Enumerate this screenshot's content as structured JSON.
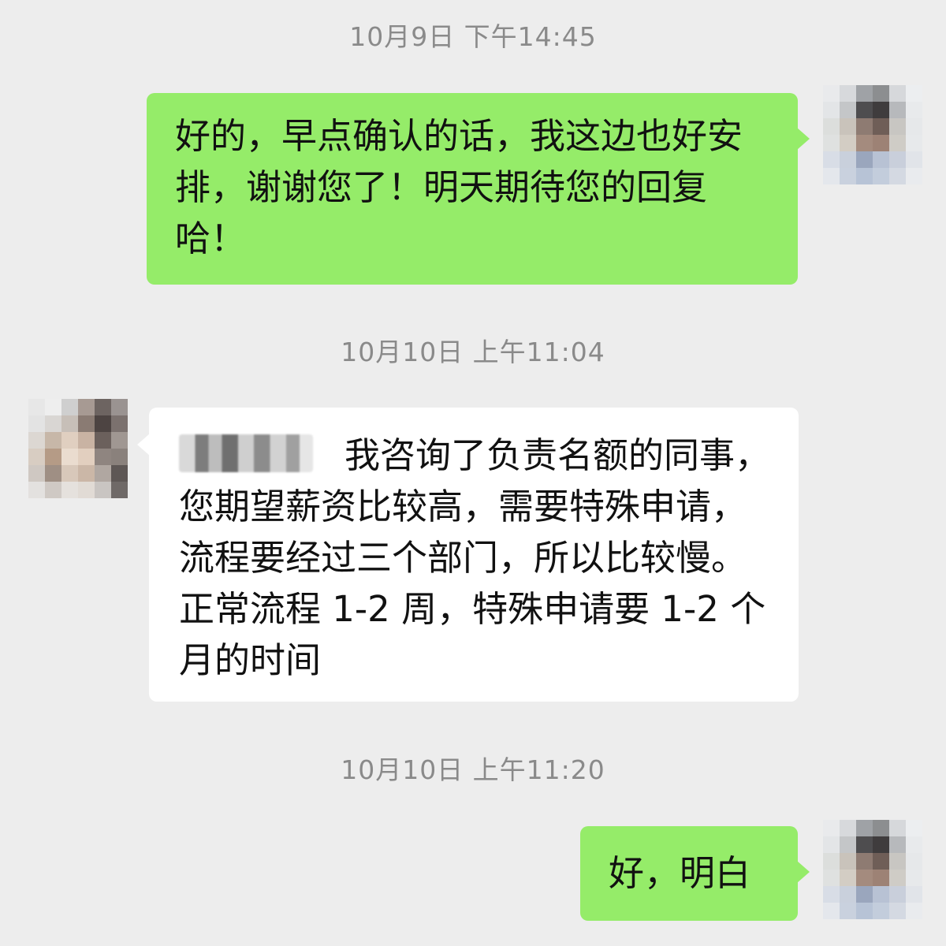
{
  "messages": [
    {
      "type": "timestamp",
      "text": "10月9日 下午14:45"
    },
    {
      "type": "outgoing",
      "text": "好的，早点确认的话，我这边也好安排，谢谢您了！明天期待您的回复哈！"
    },
    {
      "type": "timestamp",
      "text": "10月10日 上午11:04"
    },
    {
      "type": "incoming",
      "text": "我咨询了负责名额的同事，您期望薪资比较高，需要特殊申请，流程要经过三个部门，所以比较慢。正常流程 1-2 周，特殊申请要 1-2 个月的时间"
    },
    {
      "type": "timestamp",
      "text": "10月10日 上午11:20"
    },
    {
      "type": "outgoing",
      "text": "好，明白"
    }
  ],
  "avatars": {
    "self": {
      "icon": "avatar-self-pixelated"
    },
    "contact": {
      "icon": "avatar-contact-pixelated"
    }
  },
  "colors": {
    "background": "#ededed",
    "outgoing_bubble": "#95ec69",
    "incoming_bubble": "#ffffff",
    "timestamp_text": "#8a8a8a"
  }
}
